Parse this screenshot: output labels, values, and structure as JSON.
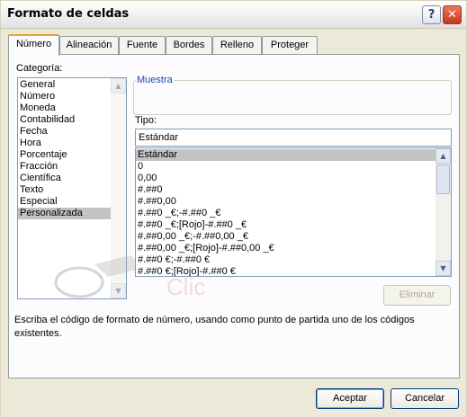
{
  "window": {
    "title": "Formato de celdas",
    "help_label": "?",
    "close_label": "✕"
  },
  "tabs": [
    {
      "label": "Número",
      "active": true
    },
    {
      "label": "Alineación",
      "active": false
    },
    {
      "label": "Fuente",
      "active": false
    },
    {
      "label": "Bordes",
      "active": false
    },
    {
      "label": "Relleno",
      "active": false
    },
    {
      "label": "Proteger",
      "active": false
    }
  ],
  "categoria": {
    "label": "Categoría:",
    "items": [
      "General",
      "Número",
      "Moneda",
      "Contabilidad",
      "Fecha",
      "Hora",
      "Porcentaje",
      "Fracción",
      "Científica",
      "Texto",
      "Especial",
      "Personalizada"
    ],
    "selected_index": 11
  },
  "muestra": {
    "legend": "Muestra",
    "value": ""
  },
  "tipo": {
    "label": "Tipo:",
    "value": "Estándar",
    "items": [
      "Estándar",
      "0",
      "0,00",
      "#.##0",
      "#.##0,00",
      "#.##0 _€;-#.##0 _€",
      "#.##0 _€;[Rojo]-#.##0 _€",
      "#.##0,00 _€;-#.##0,00 _€",
      "#.##0,00 _€;[Rojo]-#.##0,00 _€",
      "#.##0 €;-#.##0 €",
      "#.##0 €;[Rojo]-#.##0 €"
    ],
    "selected_index": 0
  },
  "eliminar_label": "Eliminar",
  "watermark_text": "Clic",
  "description": "Escriba el código de formato de número, usando como punto de partida uno de los códigos existentes.",
  "buttons": {
    "accept": "Aceptar",
    "cancel": "Cancelar"
  },
  "colors": {
    "accent": "#1c4aa8",
    "tab_highlight": "#e8a33c",
    "selection": "#c3c3c3"
  }
}
